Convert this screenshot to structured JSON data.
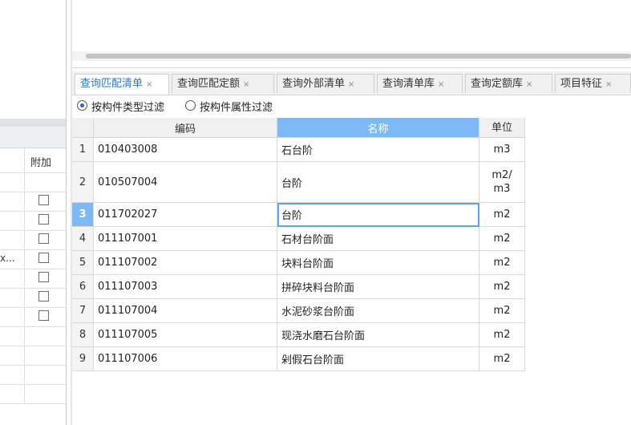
{
  "left_panel": {
    "column_header": "附加",
    "truncated_text": "x...",
    "checkbox_rows": [
      false,
      false,
      false,
      false,
      false,
      false,
      false
    ]
  },
  "tabs": [
    {
      "label": "查询匹配清单",
      "close": "×",
      "active": true
    },
    {
      "label": "查询匹配定额",
      "close": "×",
      "active": false
    },
    {
      "label": "查询外部清单",
      "close": "×",
      "active": false
    },
    {
      "label": "查询清单库",
      "close": "×",
      "active": false
    },
    {
      "label": "查询定额库",
      "close": "×",
      "active": false
    },
    {
      "label": "项目特征",
      "close": "×",
      "active": false
    }
  ],
  "filters": {
    "by_type_label": "按构件类型过滤",
    "by_attr_label": "按构件属性过滤",
    "selected": "by_type"
  },
  "table": {
    "headers": {
      "code": "编码",
      "name": "名称",
      "unit": "单位"
    },
    "selected_row": 3,
    "rows": [
      {
        "idx": "1",
        "code": "010403008",
        "name": "石台阶",
        "unit": "m3"
      },
      {
        "idx": "2",
        "code": "010507004",
        "name": "台阶",
        "unit": "m2/\nm3"
      },
      {
        "idx": "3",
        "code": "011702027",
        "name": "台阶",
        "unit": "m2"
      },
      {
        "idx": "4",
        "code": "011107001",
        "name": "石材台阶面",
        "unit": "m2"
      },
      {
        "idx": "5",
        "code": "011107002",
        "name": "块料台阶面",
        "unit": "m2"
      },
      {
        "idx": "6",
        "code": "011107003",
        "name": "拼碎块料台阶面",
        "unit": "m2"
      },
      {
        "idx": "7",
        "code": "011107004",
        "name": "水泥砂浆台阶面",
        "unit": "m2"
      },
      {
        "idx": "8",
        "code": "011107005",
        "name": "现浇水磨石台阶面",
        "unit": "m2"
      },
      {
        "idx": "9",
        "code": "011107006",
        "name": "剁假石台阶面",
        "unit": "m2"
      }
    ]
  }
}
